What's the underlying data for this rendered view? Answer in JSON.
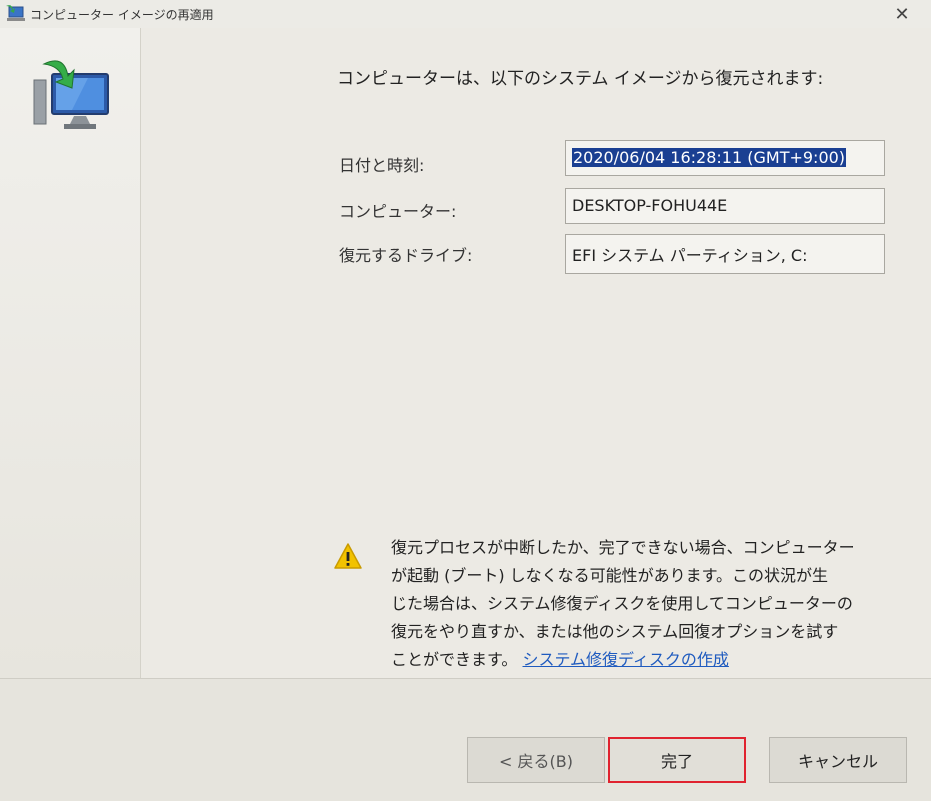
{
  "window": {
    "title": "コンピューター イメージの再適用",
    "close_glyph": "✕"
  },
  "main": {
    "heading": "コンピューターは、以下のシステム イメージから復元されます:",
    "fields": [
      {
        "label": "日付と時刻:",
        "value": "2020/06/04 16:28:11 (GMT+9:00)",
        "selected": true
      },
      {
        "label": "コンピューター:",
        "value": "DESKTOP-FOHU44E",
        "selected": false
      },
      {
        "label": "復元するドライブ:",
        "value": "EFI システム パーティション, C:",
        "selected": false
      }
    ],
    "warning": {
      "icon": "warning-icon",
      "lines": [
        "復元プロセスが中断したか、完了できない場合、コンピューター",
        "が起動 (ブート) しなくなる可能性があります。この状況が生",
        "じた場合は、システム修復ディスクを使用してコンピューターの",
        "復元をやり直すか、または他のシステム回復オプションを試す",
        "ことができます。"
      ],
      "link": "システム修復ディスクの作成"
    }
  },
  "footer": {
    "back_label": "< 戻る(B)",
    "finish_label": "完了",
    "cancel_label": "キャンセル"
  },
  "colors": {
    "selection": "#1a3f92",
    "link": "#1f5bbf",
    "highlight_border": "#e0232f",
    "warning": "#f2c200"
  }
}
